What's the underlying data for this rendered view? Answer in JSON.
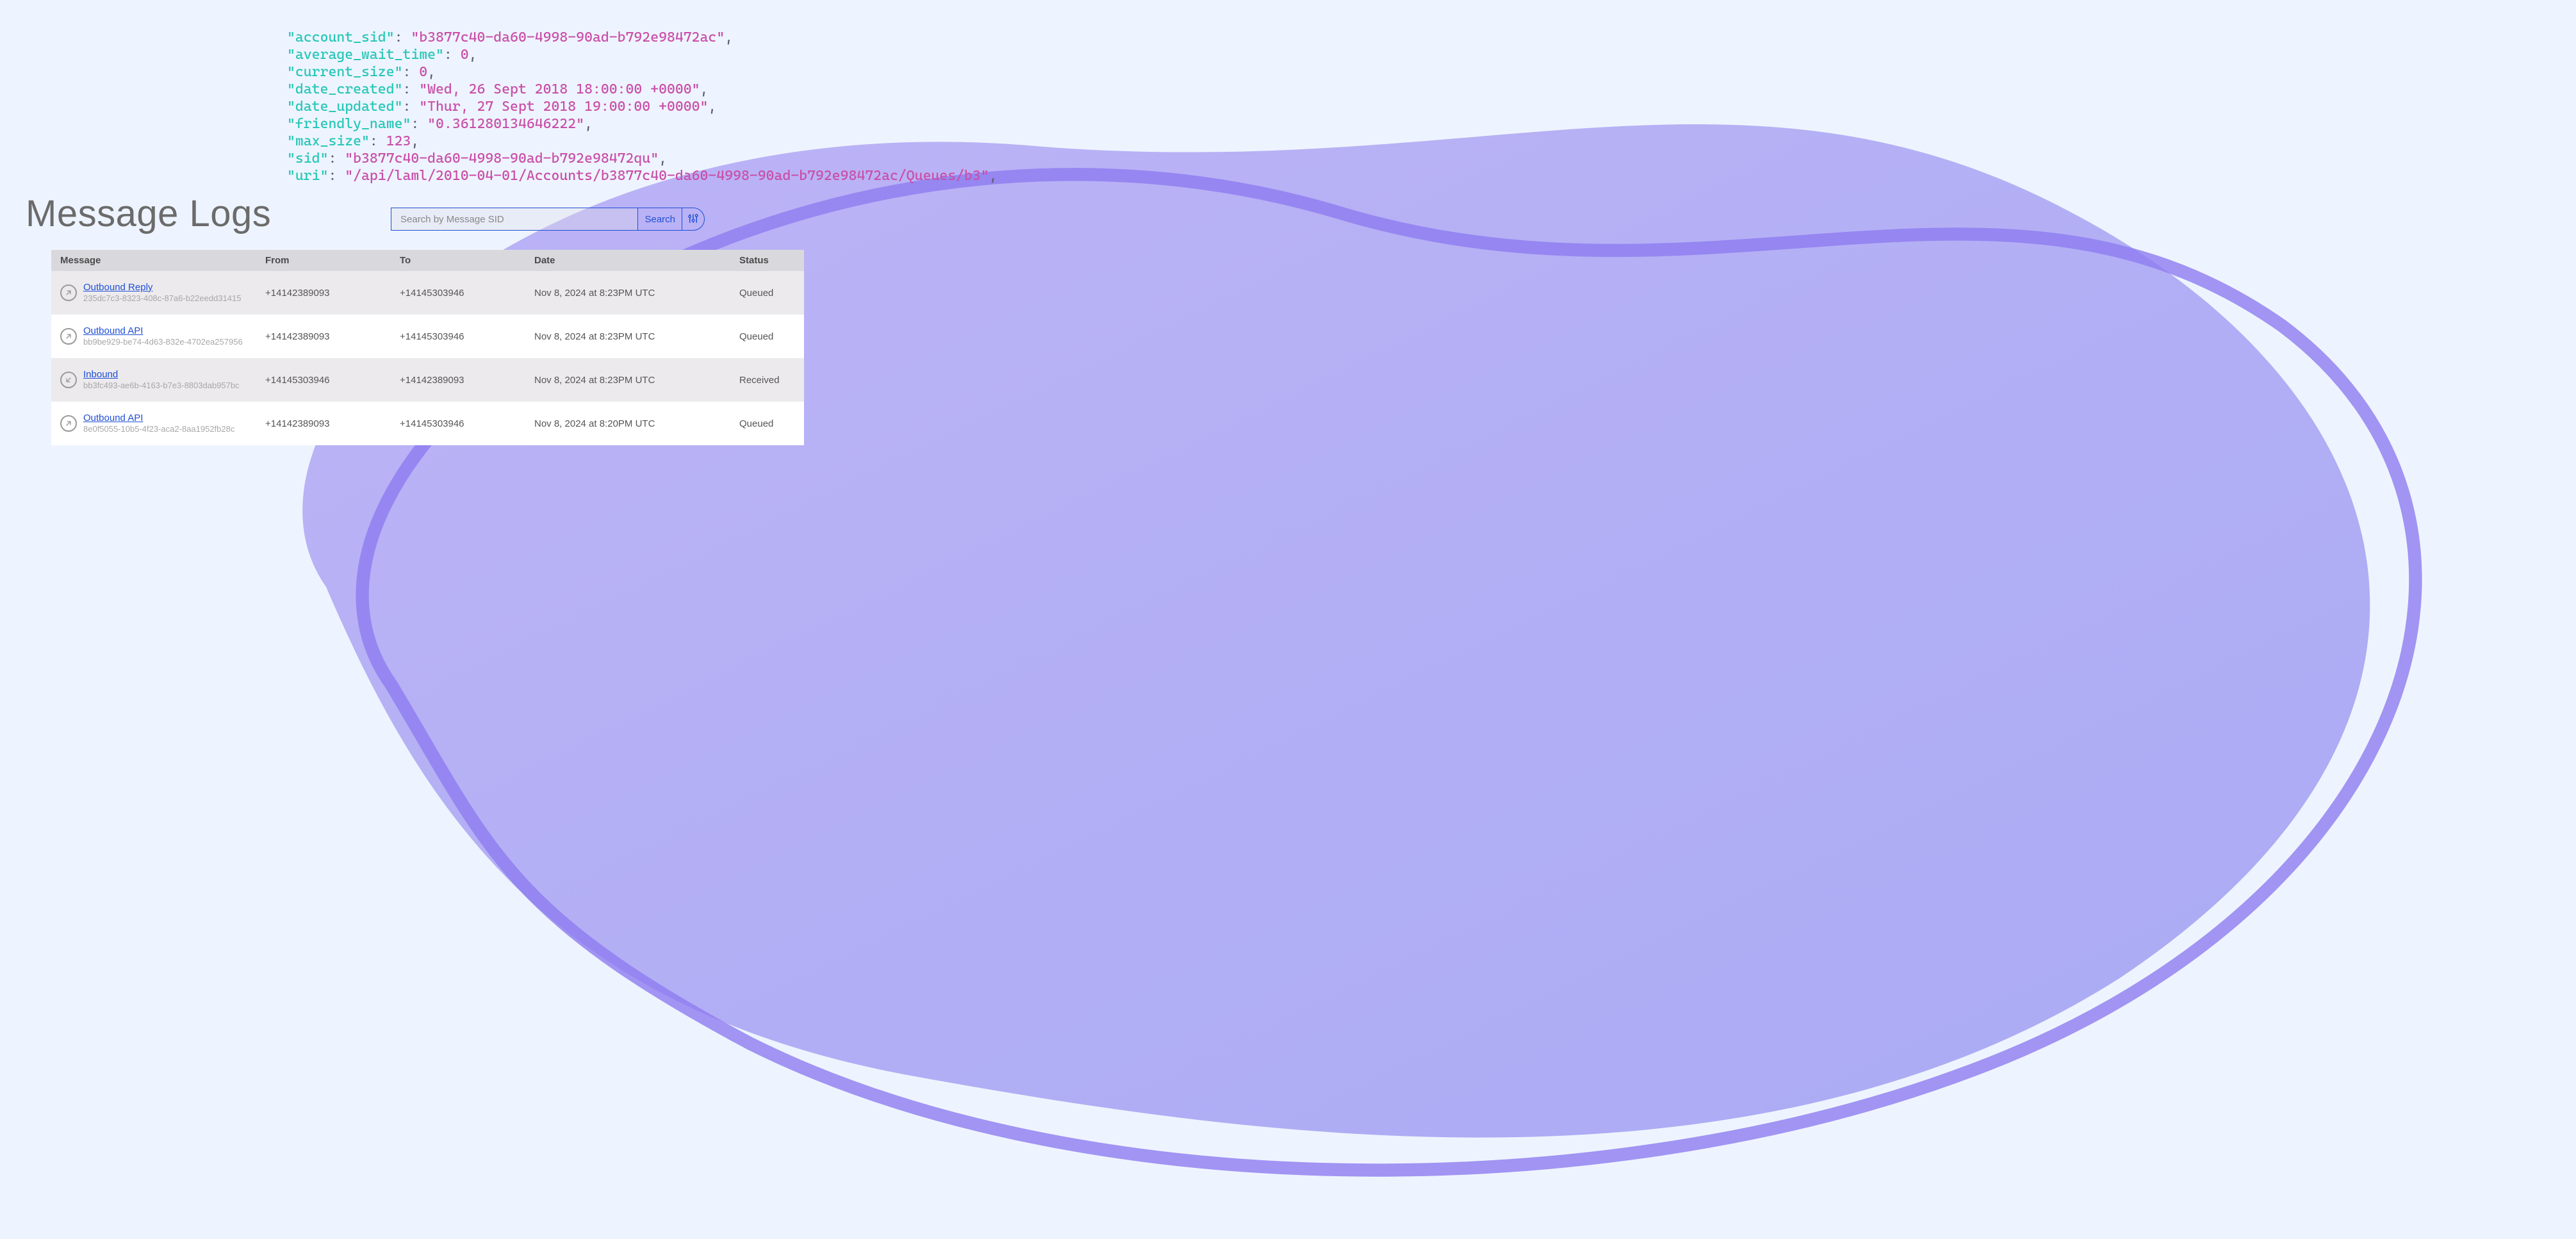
{
  "code": {
    "account_sid": "b3877c40-da60-4998-90ad-b792e98472ac",
    "average_wait_time": 0,
    "current_size": 0,
    "date_created": "Wed, 26 Sept 2018 18:00:00 +0000",
    "date_updated": "Thur, 27 Sept 2018 19:00:00 +0000",
    "friendly_name": "0.361280134646222",
    "max_size": 123,
    "sid": "b3877c40-da60-4998-90ad-b792e98472qu",
    "uri": "/api/laml/2010-04-01/Accounts/b3877c40-da60-4998-90ad-b792e98472ac/Queues/b3"
  },
  "title": "Message Logs",
  "search": {
    "placeholder": "Search by Message SID",
    "button": "Search"
  },
  "columns": {
    "msg": "Message",
    "from": "From",
    "to": "To",
    "date": "Date",
    "status": "Status"
  },
  "rows": [
    {
      "direction": "out",
      "type": "Outbound Reply",
      "sid": "235dc7c3-8323-408c-87a6-b22eedd31415",
      "from": "+14142389093",
      "to": "+14145303946",
      "date": "Nov 8, 2024 at 8:23PM UTC",
      "status": "Queued"
    },
    {
      "direction": "out",
      "type": "Outbound API",
      "sid": "bb9be929-be74-4d63-832e-4702ea257956",
      "from": "+14142389093",
      "to": "+14145303946",
      "date": "Nov 8, 2024 at 8:23PM UTC",
      "status": "Queued"
    },
    {
      "direction": "in",
      "type": "Inbound",
      "sid": "bb3fc493-ae6b-4163-b7e3-8803dab957bc",
      "from": "+14145303946",
      "to": "+14142389093",
      "date": "Nov 8, 2024 at 8:23PM UTC",
      "status": "Received"
    },
    {
      "direction": "out",
      "type": "Outbound API",
      "sid": "8e0f5055-10b5-4f23-aca2-8aa1952fb28c",
      "from": "+14142389093",
      "to": "+14145303946",
      "date": "Nov 8, 2024 at 8:20PM UTC",
      "status": "Queued"
    }
  ]
}
